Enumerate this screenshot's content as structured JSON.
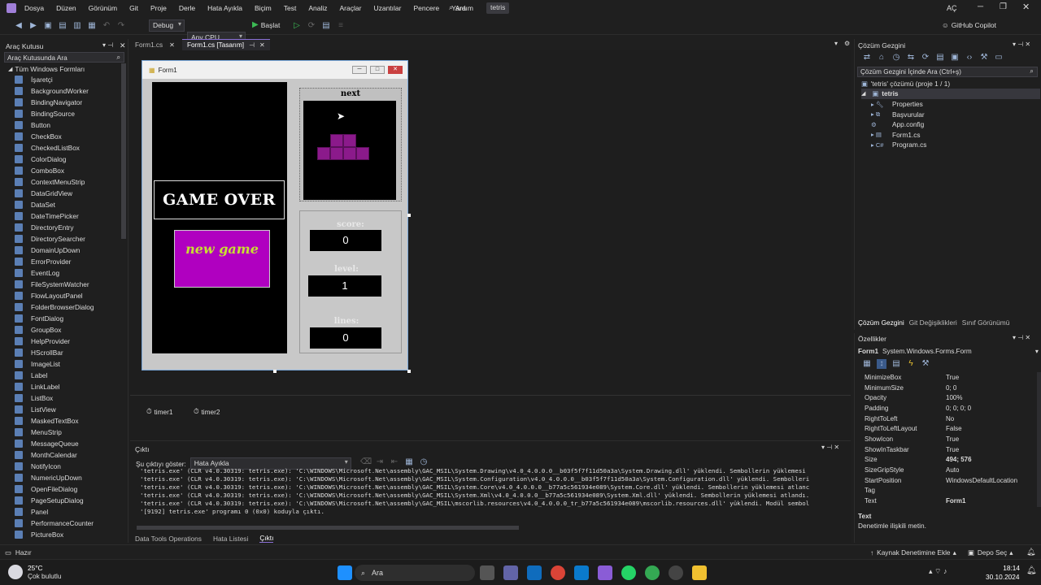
{
  "menu": {
    "items": [
      "Dosya",
      "Düzen",
      "Görünüm",
      "Git",
      "Proje",
      "Derle",
      "Hata Ayıkla",
      "Biçim",
      "Test",
      "Analiz",
      "Araçlar",
      "Uzantılar",
      "Pencere",
      "Yardım"
    ],
    "search_label": "Ara",
    "solution_badge": "tetris",
    "user_initials": "AÇ"
  },
  "toolbar": {
    "config": "Debug",
    "platform": "Any CPU",
    "start_label": "Başlat",
    "copilot_label": "GitHub Copilot"
  },
  "toolbox": {
    "title": "Araç Kutusu",
    "search_placeholder": "Araç Kutusunda Ara",
    "group": "Tüm Windows Formları",
    "items": [
      "İşaretçi",
      "BackgroundWorker",
      "BindingNavigator",
      "BindingSource",
      "Button",
      "CheckBox",
      "CheckedListBox",
      "ColorDialog",
      "ComboBox",
      "ContextMenuStrip",
      "DataGridView",
      "DataSet",
      "DateTimePicker",
      "DirectoryEntry",
      "DirectorySearcher",
      "DomainUpDown",
      "ErrorProvider",
      "EventLog",
      "FileSystemWatcher",
      "FlowLayoutPanel",
      "FolderBrowserDialog",
      "FontDialog",
      "GroupBox",
      "HelpProvider",
      "HScrollBar",
      "ImageList",
      "Label",
      "LinkLabel",
      "ListBox",
      "ListView",
      "MaskedTextBox",
      "MenuStrip",
      "MessageQueue",
      "MonthCalendar",
      "NotifyIcon",
      "NumericUpDown",
      "OpenFileDialog",
      "PageSetupDialog",
      "Panel",
      "PerformanceCounter",
      "PictureBox"
    ]
  },
  "tabs": [
    "Form1.cs",
    "Form1.cs [Tasarım]"
  ],
  "form": {
    "title": "Form1",
    "next_label": "next",
    "game_over": "GAME OVER",
    "new_game": "new game",
    "score_label": "score:",
    "score_value": "0",
    "level_label": "level:",
    "level_value": "1",
    "lines_label": "lines:",
    "lines_value": "0",
    "piece_color": "#8b1a8b",
    "button_color": "#b000c0",
    "button_text_color": "#c8e032"
  },
  "tray": [
    "timer1",
    "timer2"
  ],
  "output": {
    "title": "Çıktı",
    "show_from_label": "Şu çıktıyı göster:",
    "show_from_value": "Hata Ayıkla",
    "lines": [
      "'tetris.exe' (CLR v4.0.30319: tetris.exe): 'C:\\WINDOWS\\Microsoft.Net\\assembly\\GAC_MSIL\\System.Drawing\\v4.0_4.0.0.0__b03f5f7f11d50a3a\\System.Drawing.dll' yüklendi. Sembollerin yüklemesi",
      "'tetris.exe' (CLR v4.0.30319: tetris.exe): 'C:\\WINDOWS\\Microsoft.Net\\assembly\\GAC_MSIL\\System.Configuration\\v4.0_4.0.0.0__b03f5f7f11d50a3a\\System.Configuration.dll' yüklendi. Sembolleri",
      "'tetris.exe' (CLR v4.0.30319: tetris.exe): 'C:\\WINDOWS\\Microsoft.Net\\assembly\\GAC_MSIL\\System.Core\\v4.0_4.0.0.0__b77a5c561934e089\\System.Core.dll' yüklendi. Sembollerin yüklemesi atlanc",
      "'tetris.exe' (CLR v4.0.30319: tetris.exe): 'C:\\WINDOWS\\Microsoft.Net\\assembly\\GAC_MSIL\\System.Xml\\v4.0_4.0.0.0__b77a5c561934e089\\System.Xml.dll' yüklendi. Sembollerin yüklemesi atlandı.",
      "'tetris.exe' (CLR v4.0.30319: tetris.exe): 'C:\\WINDOWS\\Microsoft.Net\\assembly\\GAC_MSIL\\mscorlib.resources\\v4.0_4.0.0.0_tr_b77a5c561934e089\\mscorlib.resources.dll' yüklendi. Modül sembol",
      "'[9192] tetris.exe' programı 0 (0x0) koduyla çıktı."
    ]
  },
  "bottom_tabs": [
    "Data Tools Operations",
    "Hata Listesi",
    "Çıktı"
  ],
  "solution": {
    "title": "Çözüm Gezgini",
    "search_placeholder": "Çözüm Gezgini İçinde Ara (Ctrl+ş)",
    "root": "'tetris' çözümü (proje 1 / 1)",
    "project": "tetris",
    "items": [
      "Properties",
      "Başvurular",
      "App.config",
      "Form1.cs",
      "Program.cs"
    ],
    "tabs": [
      "Çözüm Gezgini",
      "Git Değişiklikleri",
      "Sınıf Görünümü"
    ]
  },
  "properties": {
    "title": "Özellikler",
    "object": "Form1",
    "type": "System.Windows.Forms.Form",
    "rows": [
      {
        "name": "MinimizeBox",
        "value": "True"
      },
      {
        "name": "MinimumSize",
        "value": "0; 0"
      },
      {
        "name": "Opacity",
        "value": "100%"
      },
      {
        "name": "Padding",
        "value": "0; 0; 0; 0"
      },
      {
        "name": "RightToLeft",
        "value": "No"
      },
      {
        "name": "RightToLeftLayout",
        "value": "False"
      },
      {
        "name": "ShowIcon",
        "value": "True"
      },
      {
        "name": "ShowInTaskbar",
        "value": "True"
      },
      {
        "name": "Size",
        "value": "494; 576"
      },
      {
        "name": "SizeGripStyle",
        "value": "Auto"
      },
      {
        "name": "StartPosition",
        "value": "WindowsDefaultLocation"
      },
      {
        "name": "Tag",
        "value": ""
      },
      {
        "name": "Text",
        "value": "Form1"
      }
    ],
    "desc_title": "Text",
    "desc_text": "Denetimle ilişkili metin."
  },
  "status": {
    "ready": "Hazır",
    "source_control": "Kaynak Denetimine Ekle",
    "repo": "Depo Seç"
  },
  "taskbar": {
    "temp": "25°C",
    "weather": "Çok bulutlu",
    "search": "Ara",
    "time": "18:14",
    "date": "30.10.2024"
  }
}
